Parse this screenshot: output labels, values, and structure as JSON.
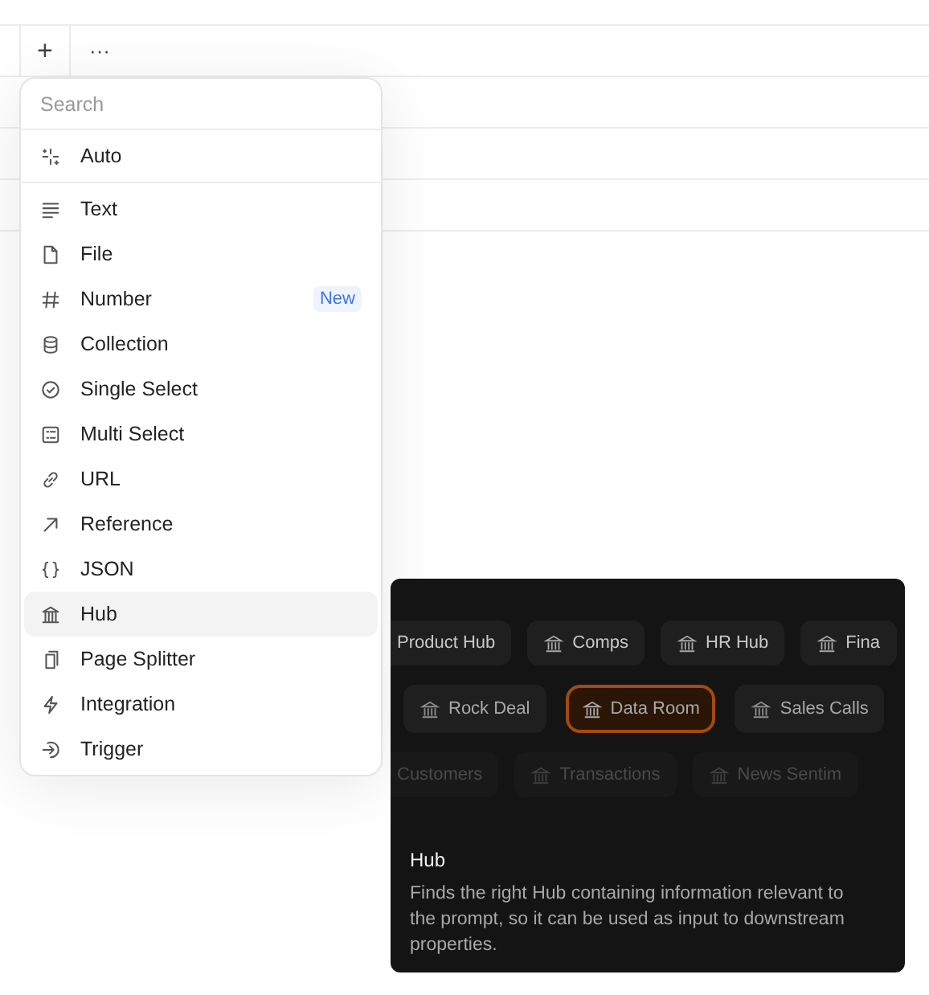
{
  "header": {
    "add_button": "+",
    "more_button": "···"
  },
  "menu": {
    "search": {
      "placeholder": "Search"
    },
    "top_items": [
      {
        "label": "Auto",
        "kind": "sparkle",
        "selected": false
      }
    ],
    "items": [
      {
        "label": "Text",
        "kind": "lines",
        "selected": false
      },
      {
        "label": "File",
        "kind": "file",
        "selected": false
      },
      {
        "label": "Number",
        "kind": "hash",
        "selected": false,
        "badge": "New"
      },
      {
        "label": "Collection",
        "kind": "stack",
        "selected": false
      },
      {
        "label": "Single Select",
        "kind": "check",
        "selected": false
      },
      {
        "label": "Multi Select",
        "kind": "multi",
        "selected": false
      },
      {
        "label": "URL",
        "kind": "link",
        "selected": false
      },
      {
        "label": "Reference",
        "kind": "arrow",
        "selected": false
      },
      {
        "label": "JSON",
        "kind": "braces",
        "selected": false
      },
      {
        "label": "Hub",
        "kind": "bank",
        "selected": true
      },
      {
        "label": "Page Splitter",
        "kind": "pages",
        "selected": false
      },
      {
        "label": "Integration",
        "kind": "bolt",
        "selected": false
      },
      {
        "label": "Trigger",
        "kind": "enter",
        "selected": false
      }
    ]
  },
  "preview": {
    "chip_rows": [
      {
        "dim": false,
        "chips": [
          {
            "label": "Product Hub",
            "kind": "cut",
            "selected": false
          },
          {
            "label": "Comps",
            "kind": "hub",
            "selected": false
          },
          {
            "label": "HR Hub",
            "kind": "hub",
            "selected": false
          },
          {
            "label": "Fina",
            "kind": "hub",
            "selected": false
          }
        ]
      },
      {
        "dim": false,
        "chips": [
          {
            "label": "Rock Deal",
            "kind": "hub",
            "selected": false
          },
          {
            "label": "Data Room",
            "kind": "hub",
            "selected": true
          },
          {
            "label": "Sales Calls",
            "kind": "hub",
            "selected": false
          }
        ]
      },
      {
        "dim": true,
        "chips": [
          {
            "label": "Customers",
            "kind": "cut",
            "selected": false
          },
          {
            "label": "Transactions",
            "kind": "hub",
            "selected": false
          },
          {
            "label": "News Sentim",
            "kind": "hub",
            "selected": false
          }
        ]
      }
    ],
    "title": "Hub",
    "description": "Finds the right Hub containing information relevant to the prompt, so it can be used as input to downstream properties."
  }
}
